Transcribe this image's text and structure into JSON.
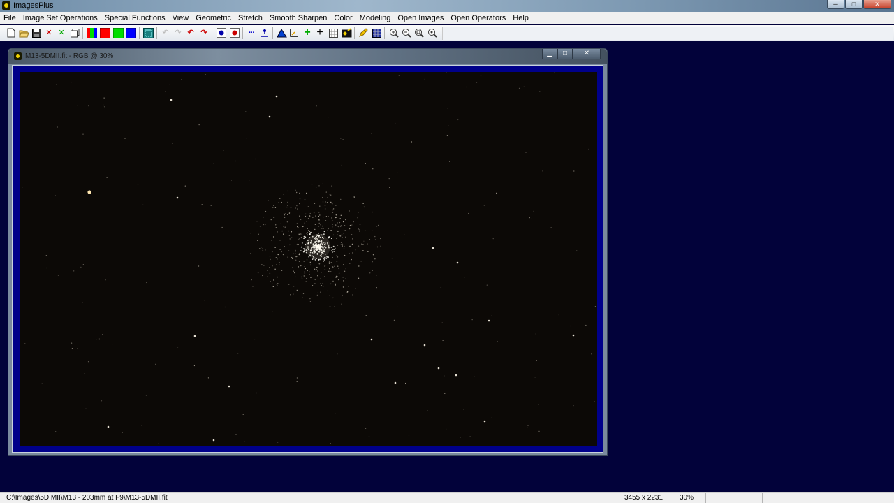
{
  "app": {
    "title": "ImagesPlus"
  },
  "menu": [
    "File",
    "Image Set Operations",
    "Special Functions",
    "View",
    "Geometric",
    "Stretch",
    "Smooth Sharpen",
    "Color",
    "Modeling",
    "Open Images",
    "Open Operators",
    "Help"
  ],
  "toolbar": {
    "icons": [
      "new-icon",
      "open-icon",
      "save-icon",
      "close-image-icon",
      "close-all-icon",
      "copy-icon",
      "rgb-channels-icon",
      "red-channel-icon",
      "green-channel-icon",
      "blue-channel-icon",
      "select-all-icon",
      "undo-disabled-icon",
      "redo-disabled-icon",
      "undo-icon",
      "redo-icon",
      "stretch-low-icon",
      "stretch-high-icon",
      "line-profile-icon",
      "point-info-icon",
      "histogram-icon",
      "axis-icon",
      "crosshair-green-icon",
      "crosshair-icon",
      "grid-select-icon",
      "image-settings-icon",
      "pencil-icon",
      "grid-icon",
      "zoom-in-icon",
      "zoom-out-icon",
      "zoom-fit-icon",
      "zoom-actual-icon"
    ],
    "colors": {
      "red": "#ff0000",
      "green": "#00dd00",
      "blue": "#0000ff"
    }
  },
  "image_window": {
    "title": "M13-5DMII.fit - RGB @ 30%",
    "min_glyph": "▁",
    "max_glyph": "□",
    "close_glyph": "✕",
    "subject": "globular cluster star field"
  },
  "statusbar": {
    "path": "C:\\Images\\5D MII\\M13 - 203mm at F9\\M13-5DMII.fit",
    "dimensions": "3455 x 2231",
    "zoom": "30%"
  },
  "window_controls": {
    "minimize": "─",
    "maximize": "□",
    "close": "✕"
  }
}
